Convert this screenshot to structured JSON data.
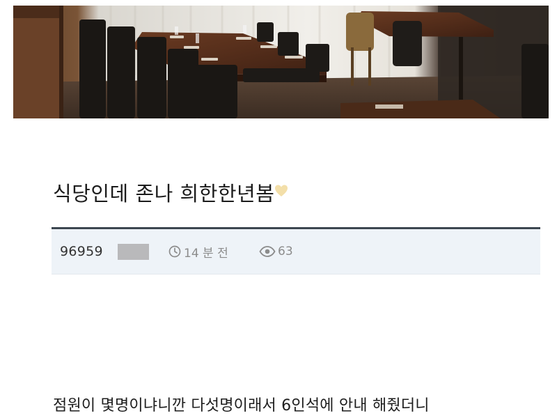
{
  "banner": {
    "image": "restaurant-interior-photo"
  },
  "post": {
    "title": "식당인데 존나 희한한년봄",
    "author": "96959",
    "time": "14 분 전",
    "views": "63",
    "body_line1": "점원이 몇명이냐니깐 다섯명이래서 6인석에 안내 해줬더니"
  },
  "icons": {
    "clock": "clock-icon",
    "views": "eye-icon",
    "sticker": "heart-sticker-icon"
  },
  "colors": {
    "title": "#1c1c1c",
    "divider": "#3c4650",
    "meta_bg": "#eef3f8",
    "meta_text": "#8c8c8c",
    "redaction": "#b9b9bb"
  }
}
